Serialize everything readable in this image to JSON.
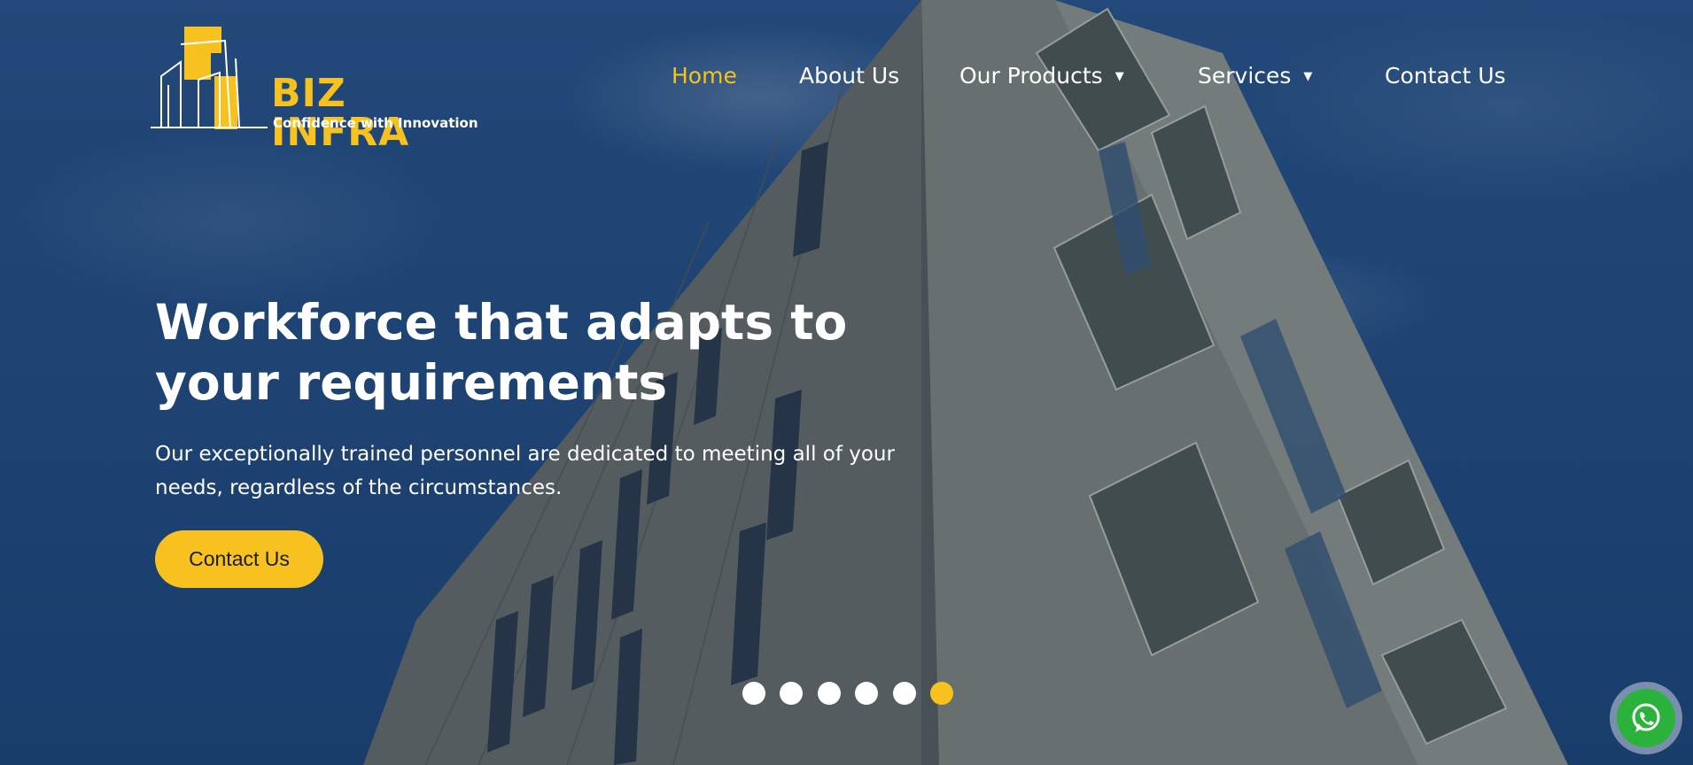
{
  "brand": {
    "name": "BIZ INFRA",
    "tagline": "Confidence with Innovation",
    "accent_color": "#f7c21f"
  },
  "nav": {
    "items": [
      {
        "label": "Home",
        "active": true,
        "has_dropdown": false
      },
      {
        "label": "About Us",
        "active": false,
        "has_dropdown": false
      },
      {
        "label": "Our Products",
        "active": false,
        "has_dropdown": true,
        "caret": "▼"
      },
      {
        "label": "Services",
        "active": false,
        "has_dropdown": true,
        "caret": "▼"
      },
      {
        "label": "Contact Us",
        "active": false,
        "has_dropdown": false
      }
    ]
  },
  "hero": {
    "headline_line1": "Workforce that adapts to",
    "headline_line2": "your requirements",
    "subtext_line1": "Our exceptionally trained personnel are dedicated to meeting all of your",
    "subtext_line2": "needs, regardless of the circumstances.",
    "cta_label": "Contact Us",
    "background_icon": "building-photo"
  },
  "slider": {
    "total_slides": 6,
    "active_slide": 6
  },
  "whatsapp": {
    "icon": "whatsapp-icon",
    "color": "#2bb23b"
  }
}
